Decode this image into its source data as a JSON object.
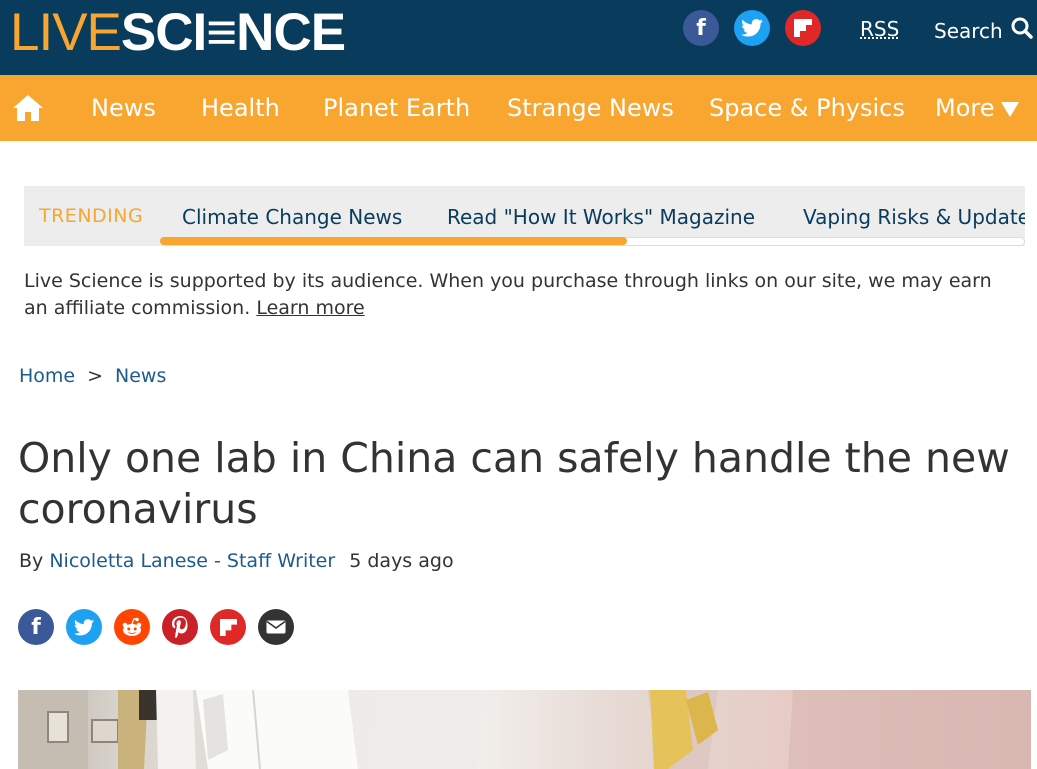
{
  "header": {
    "logo_live": "LIVE",
    "logo_science": "SCI≡NCE",
    "social": [
      "facebook-icon",
      "twitter-icon",
      "flipboard-icon"
    ],
    "rss_label": "RSS",
    "search_label": "Search"
  },
  "nav": {
    "items": [
      "News",
      "Health",
      "Planet Earth",
      "Strange News",
      "Space & Physics",
      "More"
    ]
  },
  "trending": {
    "label": "TRENDING",
    "items": [
      "Climate Change News",
      "Read \"How It Works\" Magazine",
      "Vaping Risks & Update"
    ],
    "scroll_progress": 0.54
  },
  "disclaimer": {
    "text": "Live Science is supported by its audience. When you purchase through links on our site, we may earn an affiliate commission.",
    "link": "Learn more"
  },
  "breadcrumb": {
    "home": "Home",
    "sep": ">",
    "current": "News"
  },
  "article": {
    "title": "Only one lab in China can safely handle the new coronavirus",
    "by": "By",
    "author": "Nicoletta Lanese - Staff Writer",
    "date": "5 days ago",
    "share": [
      "facebook-icon",
      "twitter-icon",
      "reddit-icon",
      "pinterest-icon",
      "flipboard-icon",
      "email-icon"
    ]
  },
  "colors": {
    "brand_navy": "#083b5c",
    "brand_orange": "#f9a630",
    "link_blue": "#1e5b8c"
  }
}
